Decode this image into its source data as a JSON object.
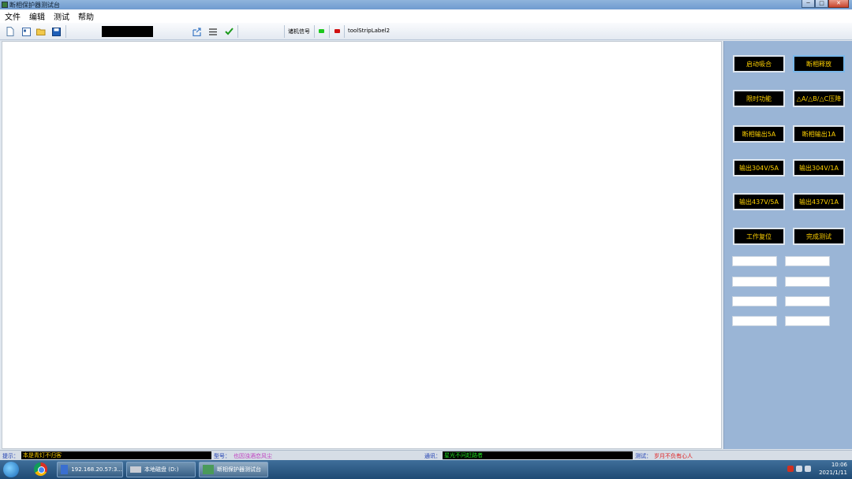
{
  "window": {
    "title": "断相保护器测试台"
  },
  "menu": [
    "文件",
    "编辑",
    "测试",
    "帮助"
  ],
  "toolbar": {
    "signal_label": "诸机信号",
    "status_label": "toolStripLabel2",
    "led_colors": {
      "green": "#1ec81e",
      "red": "#d01010"
    }
  },
  "panel": {
    "buttons": [
      [
        "启动吸合",
        "断相释放"
      ],
      [
        "限时功能",
        "△A/△B/△C压降"
      ],
      [
        "断相输出5A",
        "断相输出1A"
      ],
      [
        "输出304V/5A",
        "输出304V/1A"
      ],
      [
        "输出437V/5A",
        "输出437V/1A"
      ],
      [
        "工作复位",
        "完成测试"
      ]
    ]
  },
  "status": {
    "hint_label": "提示：",
    "hint_value": "本是青灯不归客",
    "model_label": "型号：",
    "model_value": "也因浊酒恋风尘",
    "comm_label": "通讯：",
    "comm_value": "星光不问赶路者",
    "test_label": "测试：",
    "test_value": "岁月不负有心人",
    "colors": {
      "hint": "#ffd100",
      "model": "#c040c0",
      "comm": "#20e020",
      "test": "#e02020"
    }
  },
  "taskbar": {
    "items": [
      "192.168.20.57:3...",
      "本地磁盘 (D:)",
      "断相保护器测试台"
    ],
    "time": "10:06",
    "date": "2021/1/11"
  }
}
